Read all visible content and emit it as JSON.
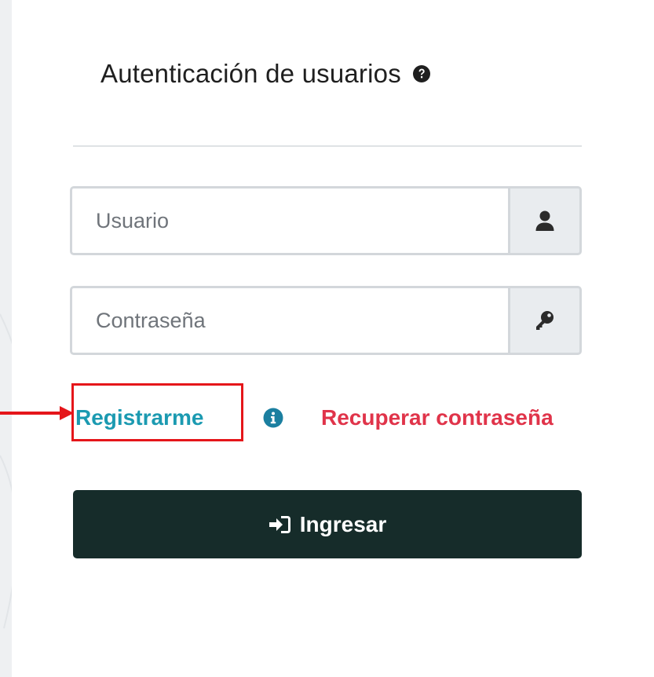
{
  "login": {
    "title": "Autenticación de usuarios",
    "username_placeholder": "Usuario",
    "password_placeholder": "Contraseña",
    "register_label": "Registrarme",
    "recover_label": "Recuperar contraseña",
    "submit_label": "Ingresar"
  },
  "icons": {
    "help": "question-circle-icon",
    "user": "user-icon",
    "password": "key-icon",
    "info": "info-circle-icon",
    "submit": "sign-in-icon"
  },
  "colors": {
    "register_link": "#1b9ab1",
    "recover_link": "#e0344a",
    "submit_button": "#162c2a",
    "annotation": "#e5161a"
  }
}
